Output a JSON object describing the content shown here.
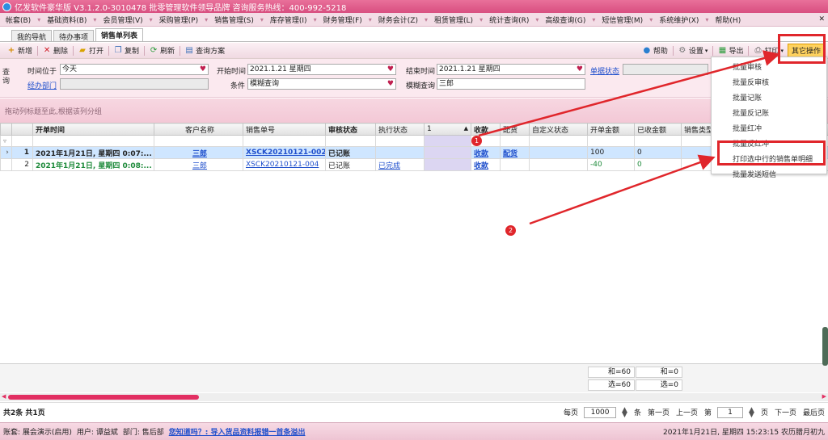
{
  "window": {
    "title": "亿发软件豪华版 V3.1.2.0-3010478 批零管理软件领导品牌 咨询服务热线：400-992-5218"
  },
  "menu": [
    "帐套(B)",
    "基础资料(B)",
    "会员管理(V)",
    "采购管理(P)",
    "销售管理(S)",
    "库存管理(I)",
    "财务管理(F)",
    "财务会计(Z)",
    "租赁管理(L)",
    "统计查询(R)",
    "高级查询(G)",
    "短信管理(M)",
    "系统维护(X)",
    "帮助(H)"
  ],
  "tabs": [
    "我的导航",
    "待办事项",
    "销售单列表"
  ],
  "toolbar": {
    "new": "新增",
    "delete": "删除",
    "open": "打开",
    "copy": "复制",
    "refresh": "刷新",
    "scheme": "查询方案",
    "help": "帮助",
    "settings": "设置",
    "export": "导出",
    "print": "打印",
    "other": "其它操作"
  },
  "query": {
    "side_label": "查询",
    "time_at_label": "时间位于",
    "time_at_value": "今天",
    "dept_label": "经办部门",
    "start_label": "开始时间",
    "start_value": "2021.1.21 星期四",
    "cond_label": "条件",
    "cond_value": "模糊查询",
    "end_label": "结束时间",
    "end_value": "2021.1.21 星期四",
    "fuzzy_label": "模糊查询",
    "fuzzy_value": "三郎",
    "doc_status_label": "单据状态"
  },
  "group_hint": "拖动列标题至此,根据该列分组",
  "grid": {
    "headers": [
      "开单时间",
      "客户名称",
      "销售单号",
      "审核状态",
      "执行状态",
      "1",
      "收款",
      "配货",
      "自定义状态",
      "开单金额",
      "已收金额",
      "销售类型"
    ],
    "rows": [
      {
        "idx": "1",
        "time": "2021年1月21日, 星期四 0:07:...",
        "customer": "三郎",
        "order": "XSCK20210121-002",
        "audit": "已记账",
        "exec": "",
        "collect": "收款",
        "dist": "配货",
        "amount": "100",
        "received": "0"
      },
      {
        "idx": "2",
        "time": "2021年1月21日, 星期四 0:08:...",
        "customer": "三郎",
        "order": "XSCK20210121-004",
        "audit": "已记账",
        "exec": "已完成",
        "collect": "收款",
        "dist": "",
        "amount": "-40",
        "received": "0"
      }
    ]
  },
  "dropdown": [
    "批量审核",
    "批量反审核",
    "批量记账",
    "批量反记账",
    "批量红冲",
    "批量反红冲",
    "打印选中行的销售单明细",
    "批量发送短信"
  ],
  "markers": [
    "1",
    "2"
  ],
  "summary": {
    "sum_amount": "和=60",
    "sum_received": "和=0",
    "sel_amount": "选=60",
    "sel_received": "选=0"
  },
  "pager": {
    "count": "共2条 共1页",
    "per_page": "每页",
    "per_page_value": "1000",
    "unit": "条",
    "first": "第一页",
    "prev": "上一页",
    "page_prefix": "第",
    "page_value": "1",
    "page_suffix": "页",
    "next": "下一页",
    "last": "最后页"
  },
  "status": {
    "account": "账套: 展会演示(启用)",
    "user": "用户: 谭益斌",
    "dept": "部门: 售后部",
    "link": "您知道吗？: 导入货品资料报错一首条溢出",
    "datetime": "2021年1月21日, 星期四 15:23:15 农历腊月初九"
  }
}
